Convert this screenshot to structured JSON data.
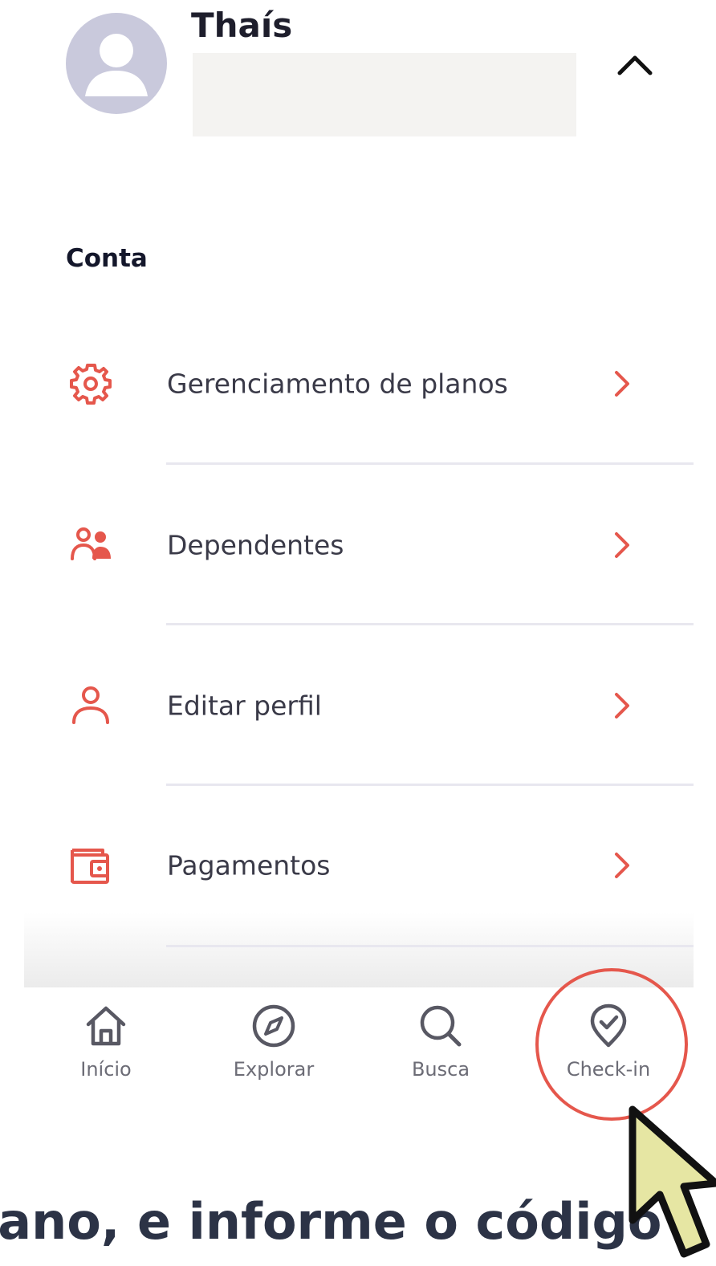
{
  "profile": {
    "name": "Thaís"
  },
  "account": {
    "section_title": "Conta",
    "items": [
      {
        "label": "Gerenciamento de planos",
        "icon": "gear-icon"
      },
      {
        "label": "Dependentes",
        "icon": "users-icon"
      },
      {
        "label": "Editar perfil",
        "icon": "user-icon"
      },
      {
        "label": "Pagamentos",
        "icon": "wallet-icon"
      }
    ]
  },
  "tabbar": {
    "tabs": [
      {
        "label": "Início",
        "icon": "home-icon"
      },
      {
        "label": "Explorar",
        "icon": "compass-icon"
      },
      {
        "label": "Busca",
        "icon": "search-icon"
      },
      {
        "label": "Check-in",
        "icon": "map-pin-check-icon"
      }
    ]
  },
  "caption": "lano, e informe o código",
  "colors": {
    "accent": "#e5574c",
    "avatar_bg": "#c9c9dc",
    "cursor_fill": "#e6e6a3",
    "caption_text": "#2c3346"
  }
}
